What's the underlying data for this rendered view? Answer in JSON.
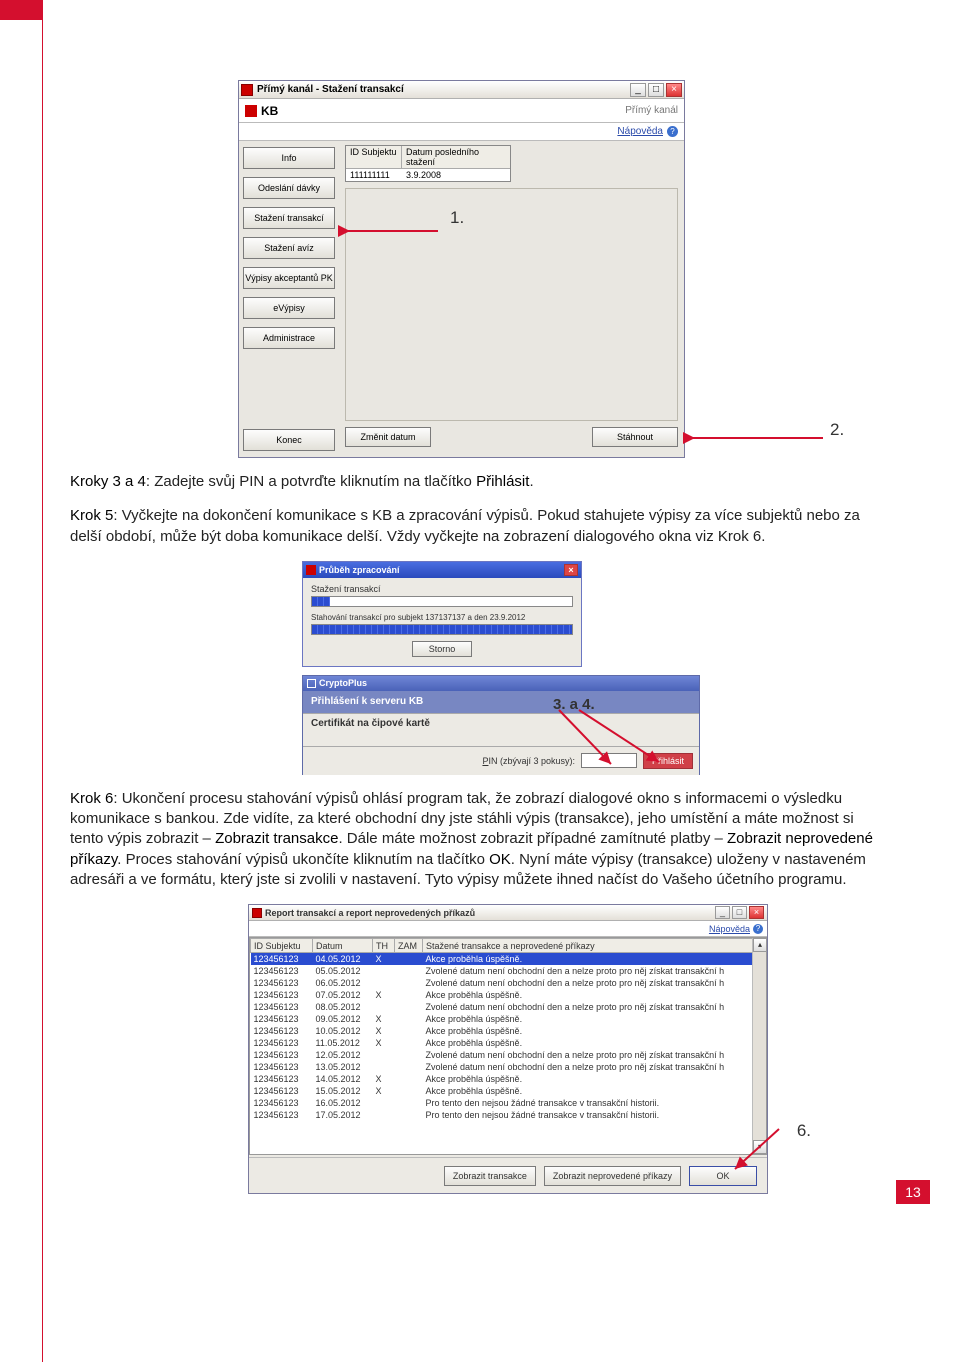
{
  "page_number": "13",
  "win1": {
    "title": "Přímý kanál - Stažení transakcí",
    "brand_kb": "KB",
    "brand_pk": "Přímý kanál",
    "help": "Nápověda",
    "sidebar": [
      "Info",
      "Odeslání dávky",
      "Stažení transakcí",
      "Stažení avíz",
      "Výpisy akceptantů PK",
      "eVýpisy",
      "Administrace"
    ],
    "sidebar_konec": "Konec",
    "tbl": {
      "h1": "ID Subjektu",
      "h2": "Datum posledního stažení",
      "v1": "111111111",
      "v2": "3.9.2008"
    },
    "btn_change": "Změnit datum",
    "btn_dl": "Stáhnout"
  },
  "annot": {
    "a1": "1.",
    "a2": "2.",
    "a34": "3. a 4.",
    "a6": "6."
  },
  "para1_prefix": "Kroky 3 a 4",
  "para1_rest": ": Zadejte svůj PIN a potvrďte kliknutím na tlačítko ",
  "para1_bold": "Přihlásit",
  "para1_end": ".",
  "para2_prefix": "Krok 5",
  "para2_rest": ": Vyčkejte na dokončení komunikace s KB a zpracování výpisů. Pokud stahujete výpisy za více subjektů nebo za delší období, může být doba komunikace delší. Vždy vyčkejte na zobrazení dialogového okna viz Krok 6.",
  "win2": {
    "title": "Průběh zpracování",
    "l1": "Stažení transakcí",
    "l2": "Stahování transakcí pro subjekt 137137137 a den 23.9.2012",
    "storno": "Storno"
  },
  "win3": {
    "title": "CryptoPlus",
    "row1": "Přihlášení k serveru KB",
    "row2": "Certifikát na čipové kartě",
    "pin_label_pre": "P",
    "pin_label_post": "IN (zbývají 3 pokusy):",
    "btn": "Přihlásit"
  },
  "para3_prefix": "Krok 6",
  "para3_a": ": Ukončení procesu stahování výpisů ohlásí program tak, že zobrazí dialogové okno s informacemi o výsledku komunikace s bankou. Zde vidíte, za které obchodní dny jste stáhli výpis (transakce), jeho umístění a máte možnost si tento výpis zobrazit – ",
  "para3_b": "Zobrazit transakce",
  "para3_c": ". Dále máte možnost zobrazit případné zamítnuté platby – ",
  "para3_d": "Zobrazit neprovedené příkazy",
  "para3_e": ". Proces stahování výpisů ukončíte kliknutím na tlačítko ",
  "para3_f": "OK",
  "para3_g": ". Nyní máte výpisy (transakce) uloženy v nastaveném adresáři a ve formátu, který jste si zvolili v nastavení. Tyto výpisy můžete ihned načíst do Vašeho účetního programu.",
  "win4": {
    "title": "Report transakcí a report neprovedených příkazů",
    "help": "Nápověda",
    "cols": {
      "c1": "ID Subjektu",
      "c2": "Datum",
      "c3": "TH",
      "c4": "ZAM",
      "c5": "Stažené transakce a neprovedené příkazy"
    },
    "rows": [
      {
        "id": "123456123",
        "d": "04.05.2012",
        "th": "X",
        "z": "",
        "m": "Akce proběhla úspěšně.",
        "sel": true
      },
      {
        "id": "123456123",
        "d": "05.05.2012",
        "th": "",
        "z": "",
        "m": "Zvolené datum není obchodní den a nelze proto pro něj získat transakční h"
      },
      {
        "id": "123456123",
        "d": "06.05.2012",
        "th": "",
        "z": "",
        "m": "Zvolené datum není obchodní den a nelze proto pro něj získat transakční h"
      },
      {
        "id": "123456123",
        "d": "07.05.2012",
        "th": "X",
        "z": "",
        "m": "Akce proběhla úspěšně."
      },
      {
        "id": "123456123",
        "d": "08.05.2012",
        "th": "",
        "z": "",
        "m": "Zvolené datum není obchodní den a nelze proto pro něj získat transakční h"
      },
      {
        "id": "123456123",
        "d": "09.05.2012",
        "th": "X",
        "z": "",
        "m": "Akce proběhla úspěšně."
      },
      {
        "id": "123456123",
        "d": "10.05.2012",
        "th": "X",
        "z": "",
        "m": "Akce proběhla úspěšně."
      },
      {
        "id": "123456123",
        "d": "11.05.2012",
        "th": "X",
        "z": "",
        "m": "Akce proběhla úspěšně."
      },
      {
        "id": "123456123",
        "d": "12.05.2012",
        "th": "",
        "z": "",
        "m": "Zvolené datum není obchodní den a nelze proto pro něj získat transakční h"
      },
      {
        "id": "123456123",
        "d": "13.05.2012",
        "th": "",
        "z": "",
        "m": "Zvolené datum není obchodní den a nelze proto pro něj získat transakční h"
      },
      {
        "id": "123456123",
        "d": "14.05.2012",
        "th": "X",
        "z": "",
        "m": "Akce proběhla úspěšně."
      },
      {
        "id": "123456123",
        "d": "15.05.2012",
        "th": "X",
        "z": "",
        "m": "Akce proběhla úspěšně."
      },
      {
        "id": "123456123",
        "d": "16.05.2012",
        "th": "",
        "z": "",
        "m": "Pro tento den nejsou žádné transakce v transakční historii."
      },
      {
        "id": "123456123",
        "d": "17.05.2012",
        "th": "",
        "z": "",
        "m": "Pro tento den nejsou žádné transakce v transakční historii."
      }
    ],
    "btn1": "Zobrazit transakce",
    "btn2": "Zobrazit neprovedené příkazy",
    "btn3": "OK"
  }
}
